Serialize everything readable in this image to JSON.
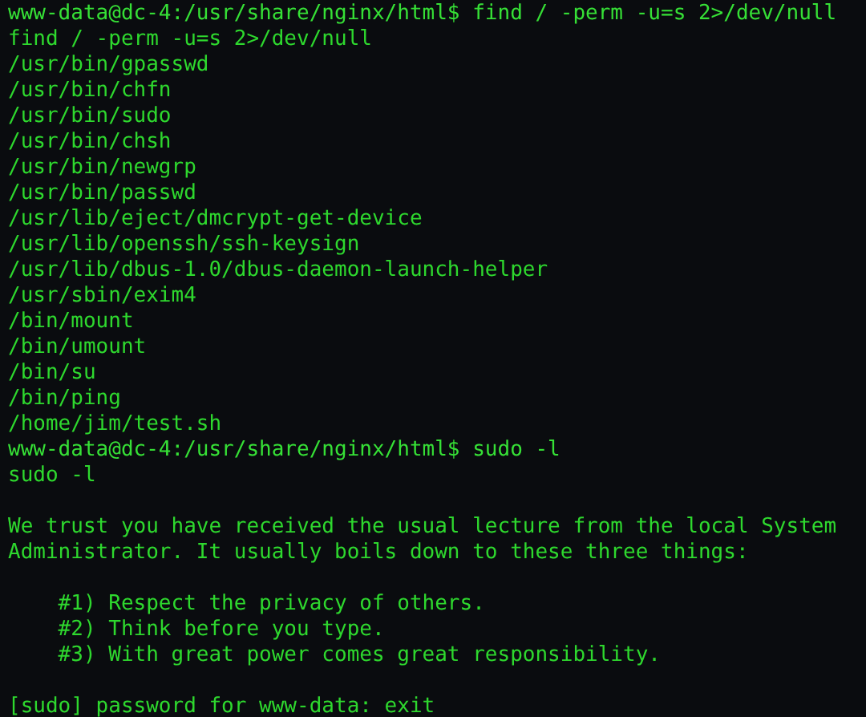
{
  "terminal": {
    "lines": [
      {
        "kind": "prompt",
        "text": "www-data@dc-4:/usr/share/nginx/html$ find / -perm -u=s 2>/dev/null"
      },
      {
        "kind": "output",
        "text": "find / -perm -u=s 2>/dev/null"
      },
      {
        "kind": "output",
        "text": "/usr/bin/gpasswd"
      },
      {
        "kind": "output",
        "text": "/usr/bin/chfn"
      },
      {
        "kind": "output",
        "text": "/usr/bin/sudo"
      },
      {
        "kind": "output",
        "text": "/usr/bin/chsh"
      },
      {
        "kind": "output",
        "text": "/usr/bin/newgrp"
      },
      {
        "kind": "output",
        "text": "/usr/bin/passwd"
      },
      {
        "kind": "output",
        "text": "/usr/lib/eject/dmcrypt-get-device"
      },
      {
        "kind": "output",
        "text": "/usr/lib/openssh/ssh-keysign"
      },
      {
        "kind": "output",
        "text": "/usr/lib/dbus-1.0/dbus-daemon-launch-helper"
      },
      {
        "kind": "output",
        "text": "/usr/sbin/exim4"
      },
      {
        "kind": "output",
        "text": "/bin/mount"
      },
      {
        "kind": "output",
        "text": "/bin/umount"
      },
      {
        "kind": "output",
        "text": "/bin/su"
      },
      {
        "kind": "output",
        "text": "/bin/ping"
      },
      {
        "kind": "output",
        "text": "/home/jim/test.sh"
      },
      {
        "kind": "prompt",
        "text": "www-data@dc-4:/usr/share/nginx/html$ sudo -l"
      },
      {
        "kind": "output",
        "text": "sudo -l"
      },
      {
        "kind": "blank"
      },
      {
        "kind": "output",
        "text": "We trust you have received the usual lecture from the local System"
      },
      {
        "kind": "output",
        "text": "Administrator. It usually boils down to these three things:"
      },
      {
        "kind": "blank"
      },
      {
        "kind": "output",
        "text": "    #1) Respect the privacy of others."
      },
      {
        "kind": "output",
        "text": "    #2) Think before you type."
      },
      {
        "kind": "output",
        "text": "    #3) With great power comes great responsibility."
      },
      {
        "kind": "blank"
      },
      {
        "kind": "output",
        "text": "[sudo] password for www-data: exit"
      }
    ]
  }
}
